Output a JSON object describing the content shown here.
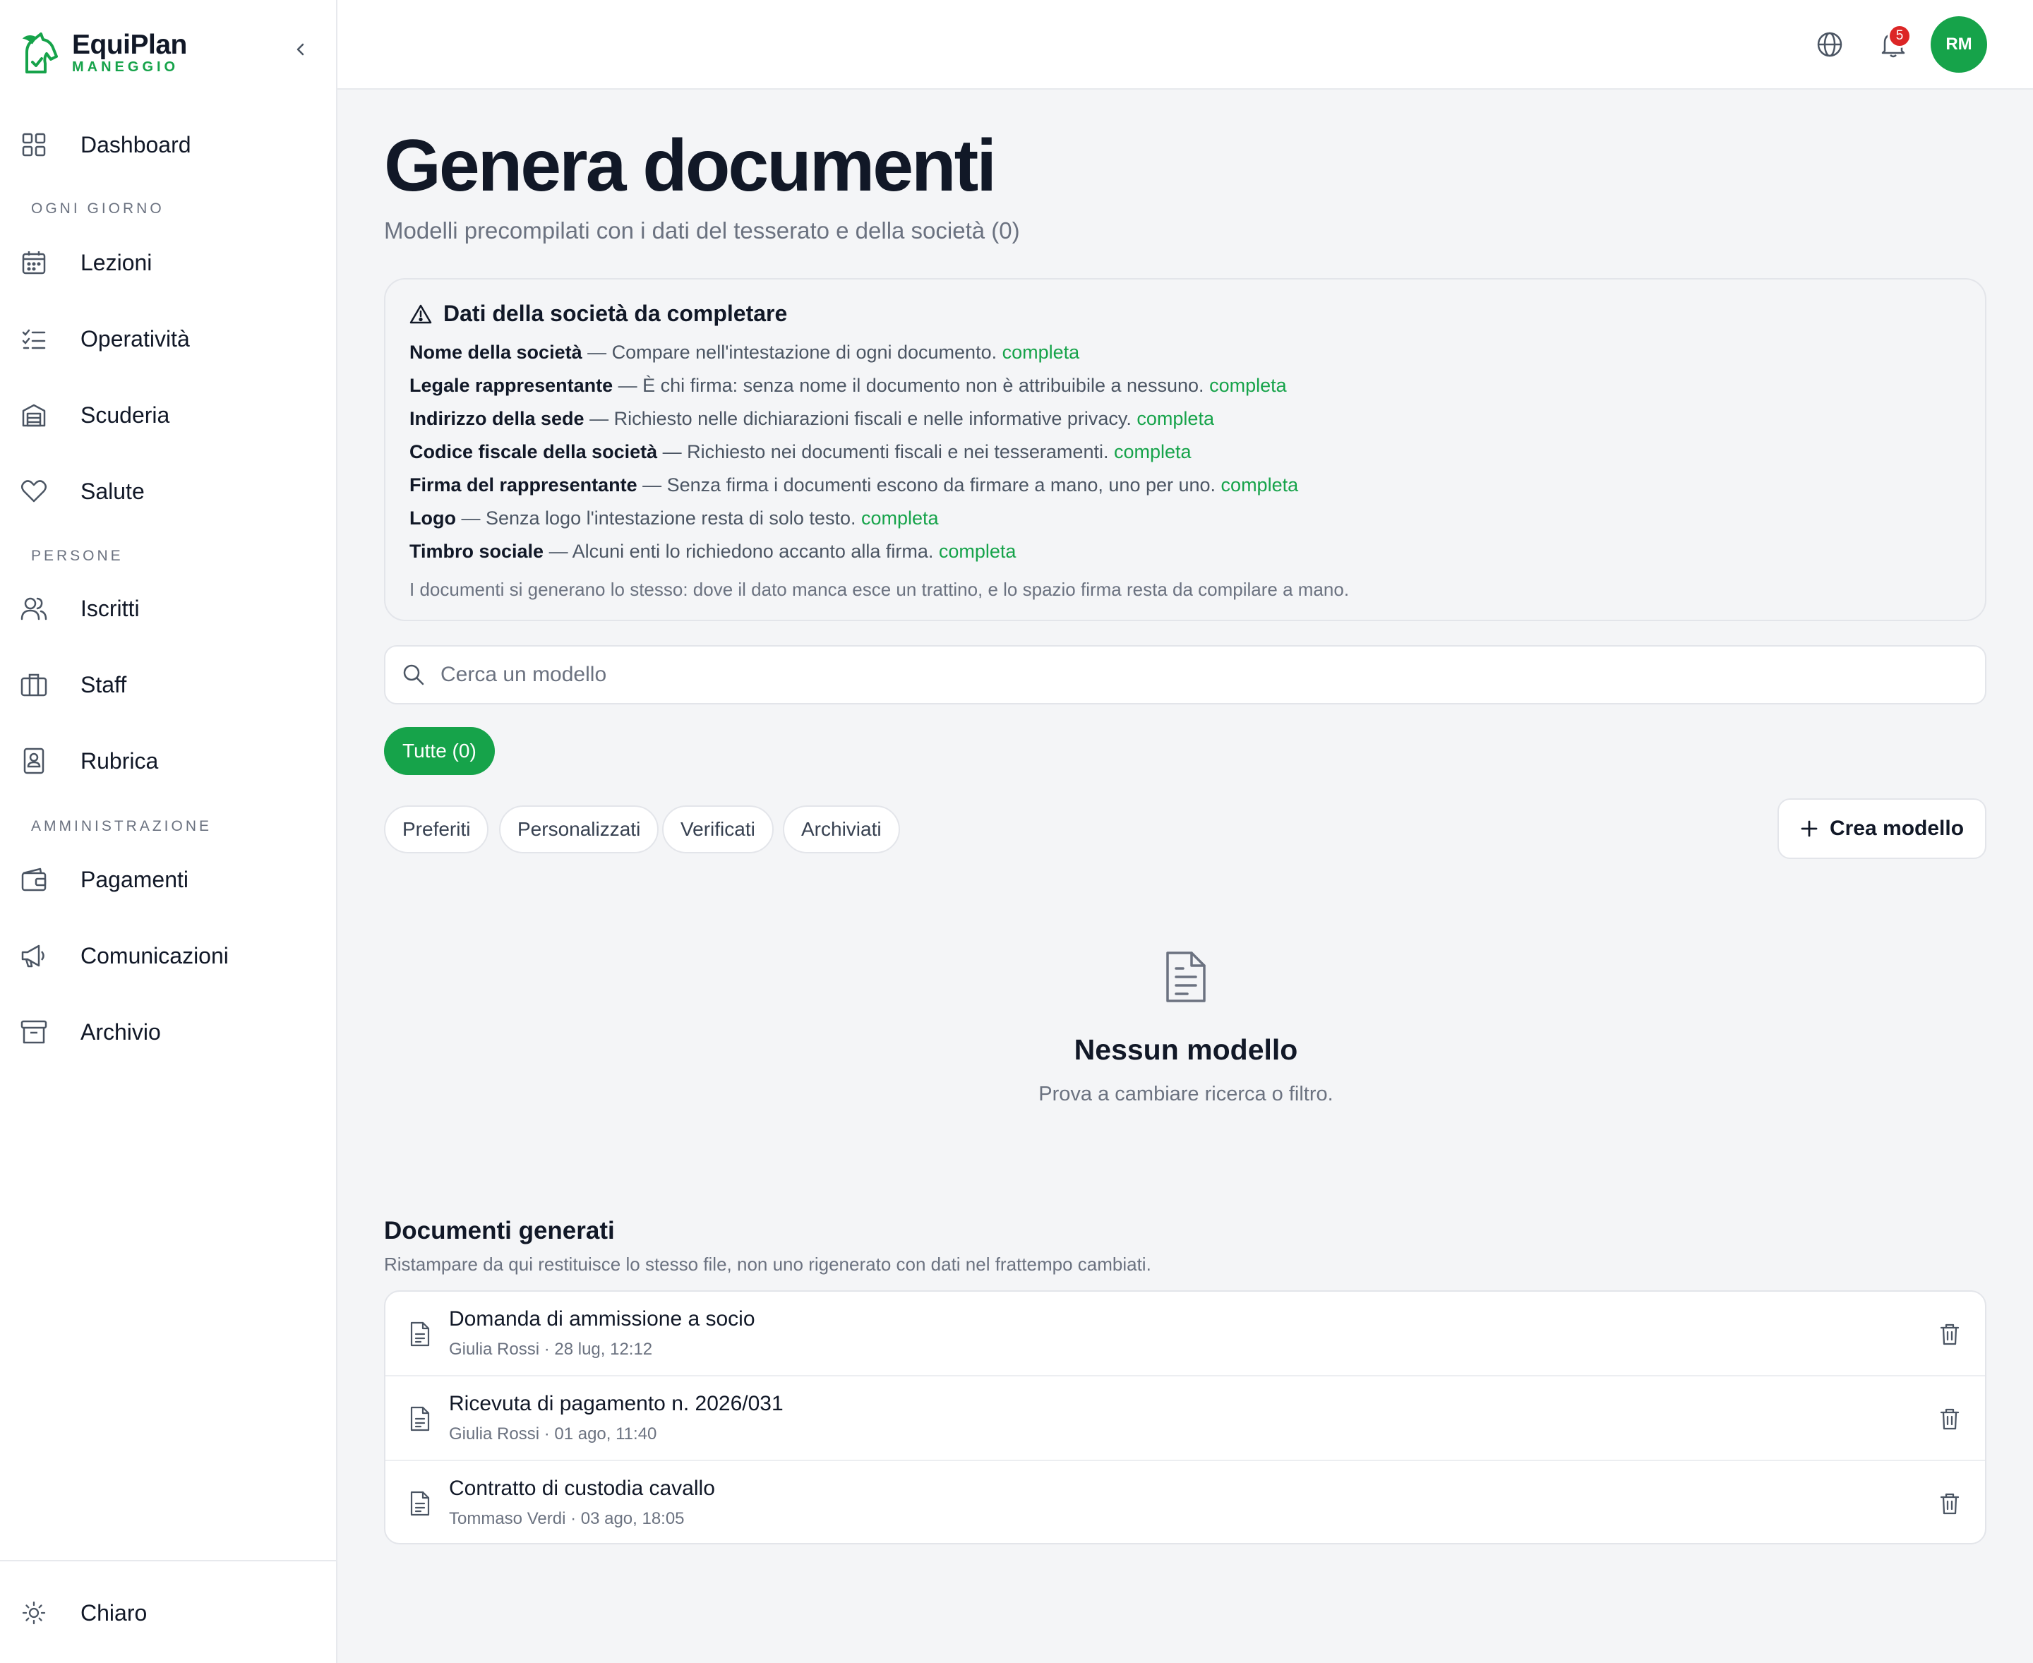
{
  "brand": {
    "name": "EquiPlan",
    "sub": "MANEGGIO",
    "accent": "#16a34a"
  },
  "sidebar": {
    "items": [
      {
        "label": "Dashboard",
        "icon": "grid-icon"
      },
      {
        "section": "OGNI GIORNO"
      },
      {
        "label": "Lezioni",
        "icon": "calendar-icon"
      },
      {
        "label": "Operatività",
        "icon": "checklist-icon"
      },
      {
        "label": "Scuderia",
        "icon": "stable-icon"
      },
      {
        "label": "Salute",
        "icon": "heart-icon"
      },
      {
        "section": "PERSONE"
      },
      {
        "label": "Iscritti",
        "icon": "users-icon"
      },
      {
        "label": "Staff",
        "icon": "briefcase-icon"
      },
      {
        "label": "Rubrica",
        "icon": "contact-book-icon"
      },
      {
        "section": "AMMINISTRAZIONE"
      },
      {
        "label": "Pagamenti",
        "icon": "wallet-icon"
      },
      {
        "label": "Comunicazioni",
        "icon": "megaphone-icon"
      },
      {
        "label": "Archivio",
        "icon": "archive-icon"
      }
    ],
    "theme_label": "Chiaro"
  },
  "topbar": {
    "notifications_count": "5",
    "avatar_initials": "RM"
  },
  "page": {
    "title": "Genera documenti",
    "subtitle": "Modelli precompilati con i dati del tesserato e della società (0)"
  },
  "warning": {
    "title": "Dati della società da completare",
    "link_label": "completa",
    "items": [
      {
        "field": "Nome della società",
        "desc": " — Compare nell'intestazione di ogni documento. "
      },
      {
        "field": "Legale rappresentante",
        "desc": " — È chi firma: senza nome il documento non è attribuibile a nessuno. "
      },
      {
        "field": "Indirizzo della sede",
        "desc": " — Richiesto nelle dichiarazioni fiscali e nelle informative privacy. "
      },
      {
        "field": "Codice fiscale della società",
        "desc": " — Richiesto nei documenti fiscali e nei tesseramenti. "
      },
      {
        "field": "Firma del rappresentante",
        "desc": " — Senza firma i documenti escono da firmare a mano, uno per uno. "
      },
      {
        "field": "Logo",
        "desc": " — Senza logo l'intestazione resta di solo testo. "
      },
      {
        "field": "Timbro sociale",
        "desc": " — Alcuni enti lo richiedono accanto alla firma. "
      }
    ],
    "footnote": "I documenti si generano lo stesso: dove il dato manca esce un trattino, e lo spazio firma resta da compilare a mano."
  },
  "search": {
    "placeholder": "Cerca un modello",
    "value": ""
  },
  "filters": {
    "active": "Tutte (0)",
    "chips": [
      "Preferiti",
      "Personalizzati",
      "Verificati",
      "Archiviati"
    ]
  },
  "create_button": "Crea modello",
  "empty": {
    "title": "Nessun modello",
    "subtitle": "Prova a cambiare ricerca o filtro."
  },
  "generated": {
    "title": "Documenti generati",
    "subtitle": "Ristampare da qui restituisce lo stesso file, non uno rigenerato con dati nel frattempo cambiati.",
    "rows": [
      {
        "name": "Domanda di ammissione a socio",
        "meta": "Giulia Rossi · 28 lug, 12:12"
      },
      {
        "name": "Ricevuta di pagamento n. 2026/031",
        "meta": "Giulia Rossi · 01 ago, 11:40"
      },
      {
        "name": "Contratto di custodia cavallo",
        "meta": "Tommaso Verdi · 03 ago, 18:05"
      }
    ]
  }
}
